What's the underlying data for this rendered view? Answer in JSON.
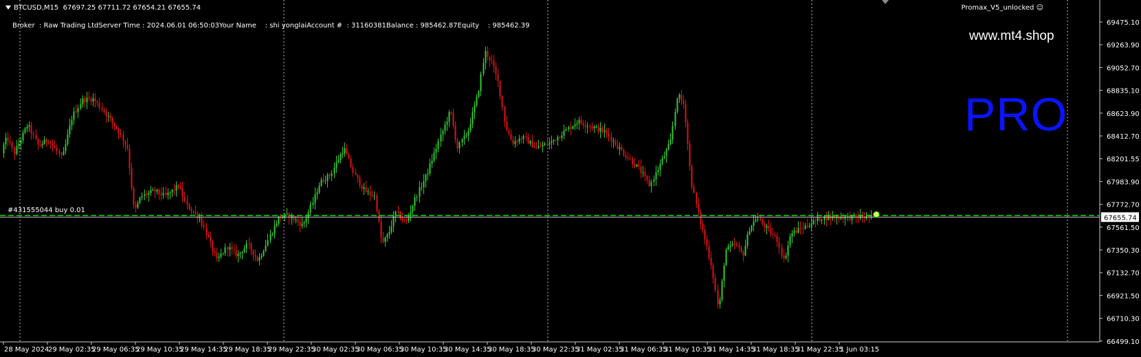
{
  "header": {
    "symbol_label": "BTCUSD,M15",
    "ohlc": "67697.25 67711.72 67654.21 67655.74"
  },
  "account_info": "Broker  : Raw Trading LtdServer Time : 2024.06.01 06:50:03Your Name    : shi yonglaiAccount #  : 31160381Balance : 985462.87Equity    : 985462.39",
  "expert_label": "Promax_V5_unlocked",
  "branding": {
    "site": "www.mt4.shop",
    "pro": "PRO"
  },
  "order_label": "#431555044 buy 0.01",
  "current_price": "67655.74",
  "price_axis": [
    "69475.10",
    "69263.90",
    "69052.70",
    "68835.10",
    "68623.90",
    "68412.70",
    "68201.55",
    "67983.90",
    "67772.70",
    "67561.50",
    "67350.30",
    "67132.70",
    "66921.50",
    "66710.30",
    "66499.10"
  ],
  "time_axis": [
    "28 May 2024",
    "29 May 02:35",
    "29 May 06:35",
    "29 May 10:35",
    "29 May 14:35",
    "29 May 18:35",
    "29 May 22:35",
    "30 May 02:35",
    "30 May 06:35",
    "30 May 10:35",
    "30 May 14:35",
    "30 May 18:35",
    "30 May 22:35",
    "31 May 02:35",
    "31 May 06:35",
    "31 May 10:35",
    "31 May 14:35",
    "31 May 18:35",
    "31 May 22:35",
    "1 Jun 03:15"
  ],
  "colors": {
    "background": "#000000",
    "bull": "#32cd32",
    "bear": "#e01414",
    "grid": "#ffffff",
    "order_line": "#00ff00",
    "pro_text": "#0a14ff"
  },
  "chart_data": {
    "type": "candlestick",
    "symbol": "BTCUSD",
    "timeframe": "M15",
    "ylim": [
      66499.1,
      69475.1
    ],
    "last": 67655.74,
    "order_price": 67672,
    "anchors": [
      [
        0,
        68250
      ],
      [
        10,
        68400
      ],
      [
        20,
        68250
      ],
      [
        40,
        68520
      ],
      [
        55,
        68320
      ],
      [
        70,
        68380
      ],
      [
        90,
        68200
      ],
      [
        105,
        68600
      ],
      [
        120,
        68750
      ],
      [
        135,
        68760
      ],
      [
        150,
        68650
      ],
      [
        170,
        68480
      ],
      [
        185,
        68300
      ],
      [
        195,
        67700
      ],
      [
        205,
        67850
      ],
      [
        225,
        67900
      ],
      [
        240,
        67850
      ],
      [
        260,
        67950
      ],
      [
        270,
        67770
      ],
      [
        290,
        67650
      ],
      [
        300,
        67500
      ],
      [
        315,
        67250
      ],
      [
        330,
        67380
      ],
      [
        345,
        67300
      ],
      [
        360,
        67400
      ],
      [
        375,
        67250
      ],
      [
        390,
        67450
      ],
      [
        405,
        67650
      ],
      [
        420,
        67670
      ],
      [
        440,
        67580
      ],
      [
        455,
        67800
      ],
      [
        465,
        67980
      ],
      [
        480,
        68050
      ],
      [
        500,
        68300
      ],
      [
        515,
        68050
      ],
      [
        530,
        67900
      ],
      [
        545,
        67850
      ],
      [
        555,
        67400
      ],
      [
        565,
        67500
      ],
      [
        575,
        67700
      ],
      [
        590,
        67600
      ],
      [
        605,
        67850
      ],
      [
        620,
        68050
      ],
      [
        640,
        68400
      ],
      [
        655,
        68650
      ],
      [
        665,
        68300
      ],
      [
        680,
        68450
      ],
      [
        695,
        68800
      ],
      [
        705,
        69200
      ],
      [
        715,
        69100
      ],
      [
        725,
        68900
      ],
      [
        735,
        68500
      ],
      [
        745,
        68350
      ],
      [
        760,
        68400
      ],
      [
        780,
        68300
      ],
      [
        800,
        68350
      ],
      [
        820,
        68450
      ],
      [
        840,
        68550
      ],
      [
        860,
        68500
      ],
      [
        880,
        68450
      ],
      [
        900,
        68300
      ],
      [
        915,
        68200
      ],
      [
        930,
        68100
      ],
      [
        945,
        67950
      ],
      [
        960,
        68150
      ],
      [
        975,
        68350
      ],
      [
        985,
        68800
      ],
      [
        995,
        68700
      ],
      [
        1005,
        68000
      ],
      [
        1015,
        67700
      ],
      [
        1025,
        67450
      ],
      [
        1035,
        67200
      ],
      [
        1045,
        66780
      ],
      [
        1055,
        67350
      ],
      [
        1070,
        67400
      ],
      [
        1080,
        67300
      ],
      [
        1090,
        67550
      ],
      [
        1100,
        67650
      ],
      [
        1115,
        67550
      ],
      [
        1130,
        67450
      ],
      [
        1140,
        67250
      ],
      [
        1150,
        67500
      ],
      [
        1165,
        67550
      ],
      [
        1180,
        67600
      ],
      [
        1195,
        67650
      ],
      [
        1205,
        67655
      ]
    ]
  }
}
